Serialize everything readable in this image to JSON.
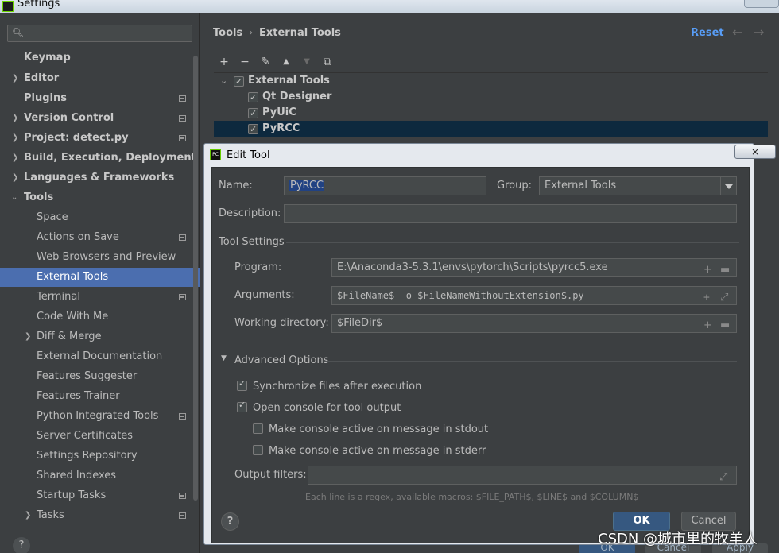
{
  "window": {
    "title": "Settings"
  },
  "sidebar": {
    "search_placeholder": "",
    "items": [
      {
        "label": "Keymap"
      },
      {
        "label": "Editor"
      },
      {
        "label": "Plugins"
      },
      {
        "label": "Version Control"
      },
      {
        "label": "Project: detect.py"
      },
      {
        "label": "Build, Execution, Deployment"
      },
      {
        "label": "Languages & Frameworks"
      },
      {
        "label": "Tools"
      },
      {
        "label": "Space"
      },
      {
        "label": "Actions on Save"
      },
      {
        "label": "Web Browsers and Preview"
      },
      {
        "label": "External Tools"
      },
      {
        "label": "Terminal"
      },
      {
        "label": "Code With Me"
      },
      {
        "label": "Diff & Merge"
      },
      {
        "label": "External Documentation"
      },
      {
        "label": "Features Suggester"
      },
      {
        "label": "Features Trainer"
      },
      {
        "label": "Python Integrated Tools"
      },
      {
        "label": "Server Certificates"
      },
      {
        "label": "Settings Repository"
      },
      {
        "label": "Shared Indexes"
      },
      {
        "label": "Startup Tasks"
      },
      {
        "label": "Tasks"
      }
    ],
    "help": "?"
  },
  "header": {
    "breadcrumb_root": "Tools",
    "breadcrumb_sep": "›",
    "breadcrumb_page": "External Tools",
    "reset": "Reset",
    "back_arrow": "←",
    "forward_arrow": "→"
  },
  "toolbar": {
    "add": "+",
    "remove": "−",
    "edit": "✎",
    "up": "▲",
    "down": "▼",
    "copy": "⧉"
  },
  "tools_tree": {
    "group": "External Tools",
    "items": [
      "Qt Designer",
      "PyUiC",
      "PyRCC"
    ]
  },
  "dialog": {
    "title": "Edit Tool",
    "icon_text": "PC",
    "close": "×",
    "name_label": "Name:",
    "name_value": "PyRCC",
    "group_label": "Group:",
    "group_value": "External Tools",
    "description_label": "Description:",
    "description_value": "",
    "tool_settings": "Tool Settings",
    "program_label": "Program:",
    "program_value": "E:\\Anaconda3-5.3.1\\envs\\pytorch\\Scripts\\pyrcc5.exe",
    "arguments_label": "Arguments:",
    "arguments_value": "$FileName$ -o $FileNameWithoutExtension$.py",
    "workdir_label": "Working directory:",
    "workdir_value": "$FileDir$",
    "advanced": "Advanced Options",
    "opt_sync": "Synchronize files after execution",
    "opt_console": "Open console for tool output",
    "opt_stdout": "Make console active on message in stdout",
    "opt_stderr": "Make console active on message in stderr",
    "output_filters_label": "Output filters:",
    "output_filters_value": "",
    "hint": "Each line is a regex, available macros: $FILE_PATH$, $LINE$ and $COLUMN$",
    "ok": "OK",
    "cancel": "Cancel",
    "help": "?"
  },
  "background_buttons": {
    "ok": "OK",
    "cancel": "Cancel",
    "apply": "Apply"
  },
  "watermark": "CSDN @城市里的牧羊人"
}
